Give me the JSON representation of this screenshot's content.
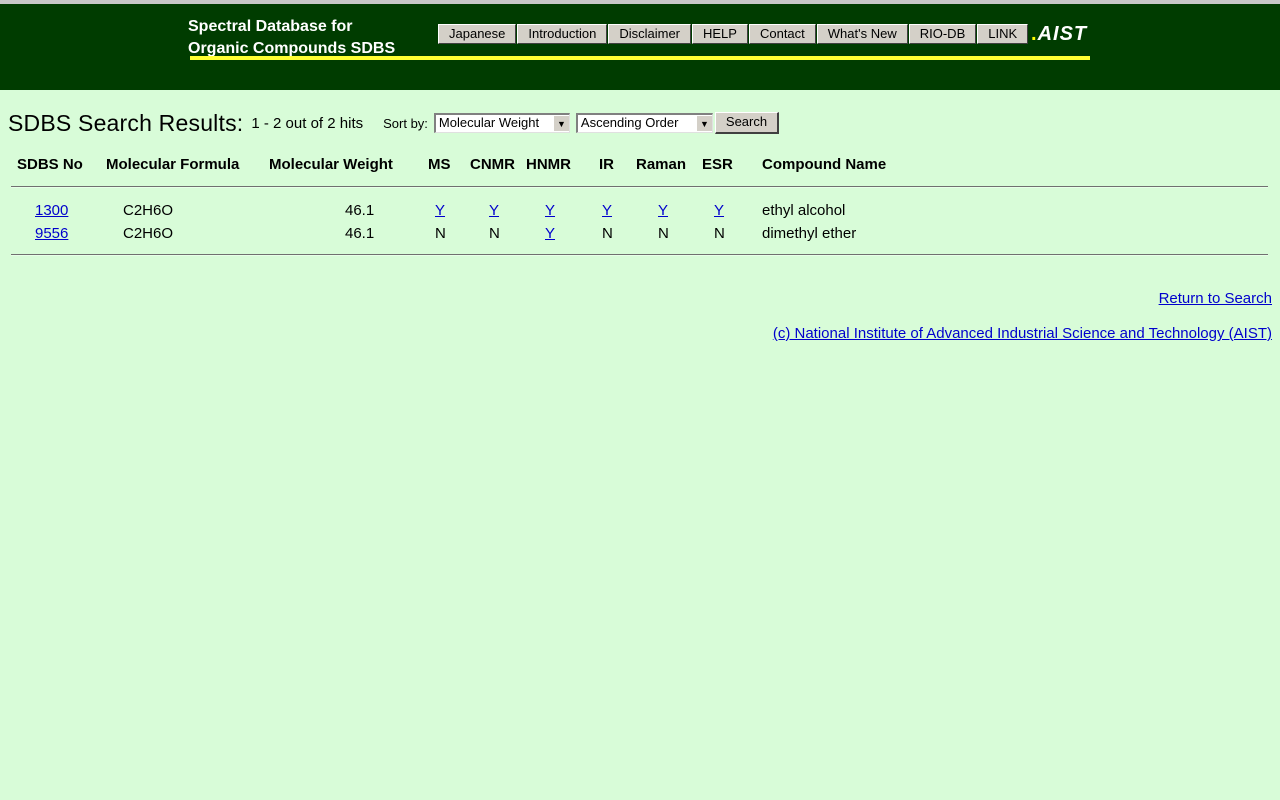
{
  "header": {
    "title_line1": "Spectral Database for",
    "title_line2": "Organic Compounds SDBS",
    "nav": [
      "Japanese",
      "Introduction",
      "Disclaimer",
      "HELP",
      "Contact",
      "What's New",
      "RIO-DB",
      "LINK"
    ],
    "logo_text": "AIST",
    "colors": {
      "banner": "#003c00",
      "accent_rule": "#ffff33",
      "page_bg": "#d8fcd8"
    }
  },
  "results": {
    "title": "SDBS Search Results:",
    "hits": "1 - 2 out of 2 hits",
    "sort_label": "Sort by:",
    "sort_field": "Molecular Weight",
    "sort_order": "Ascending Order",
    "search_button": "Search"
  },
  "table": {
    "headers": [
      "SDBS No",
      "Molecular Formula",
      "Molecular Weight",
      "MS",
      "CNMR",
      "HNMR",
      "IR",
      "Raman",
      "ESR",
      "Compound Name"
    ],
    "rows": [
      {
        "sdbs_no": "1300",
        "formula": "C2H6O",
        "mw": "46.1",
        "ms": "Y",
        "cnmr": "Y",
        "hnmr": "Y",
        "ir": "Y",
        "raman": "Y",
        "esr": "Y",
        "name": "ethyl alcohol"
      },
      {
        "sdbs_no": "9556",
        "formula": "C2H6O",
        "mw": "46.1",
        "ms": "N",
        "cnmr": "N",
        "hnmr": "Y",
        "ir": "N",
        "raman": "N",
        "esr": "N",
        "name": "dimethyl ether"
      }
    ]
  },
  "footer": {
    "return_link": "Return to Search",
    "copyright_link": "(c) National Institute of Advanced Industrial Science and Technology (AIST)"
  }
}
